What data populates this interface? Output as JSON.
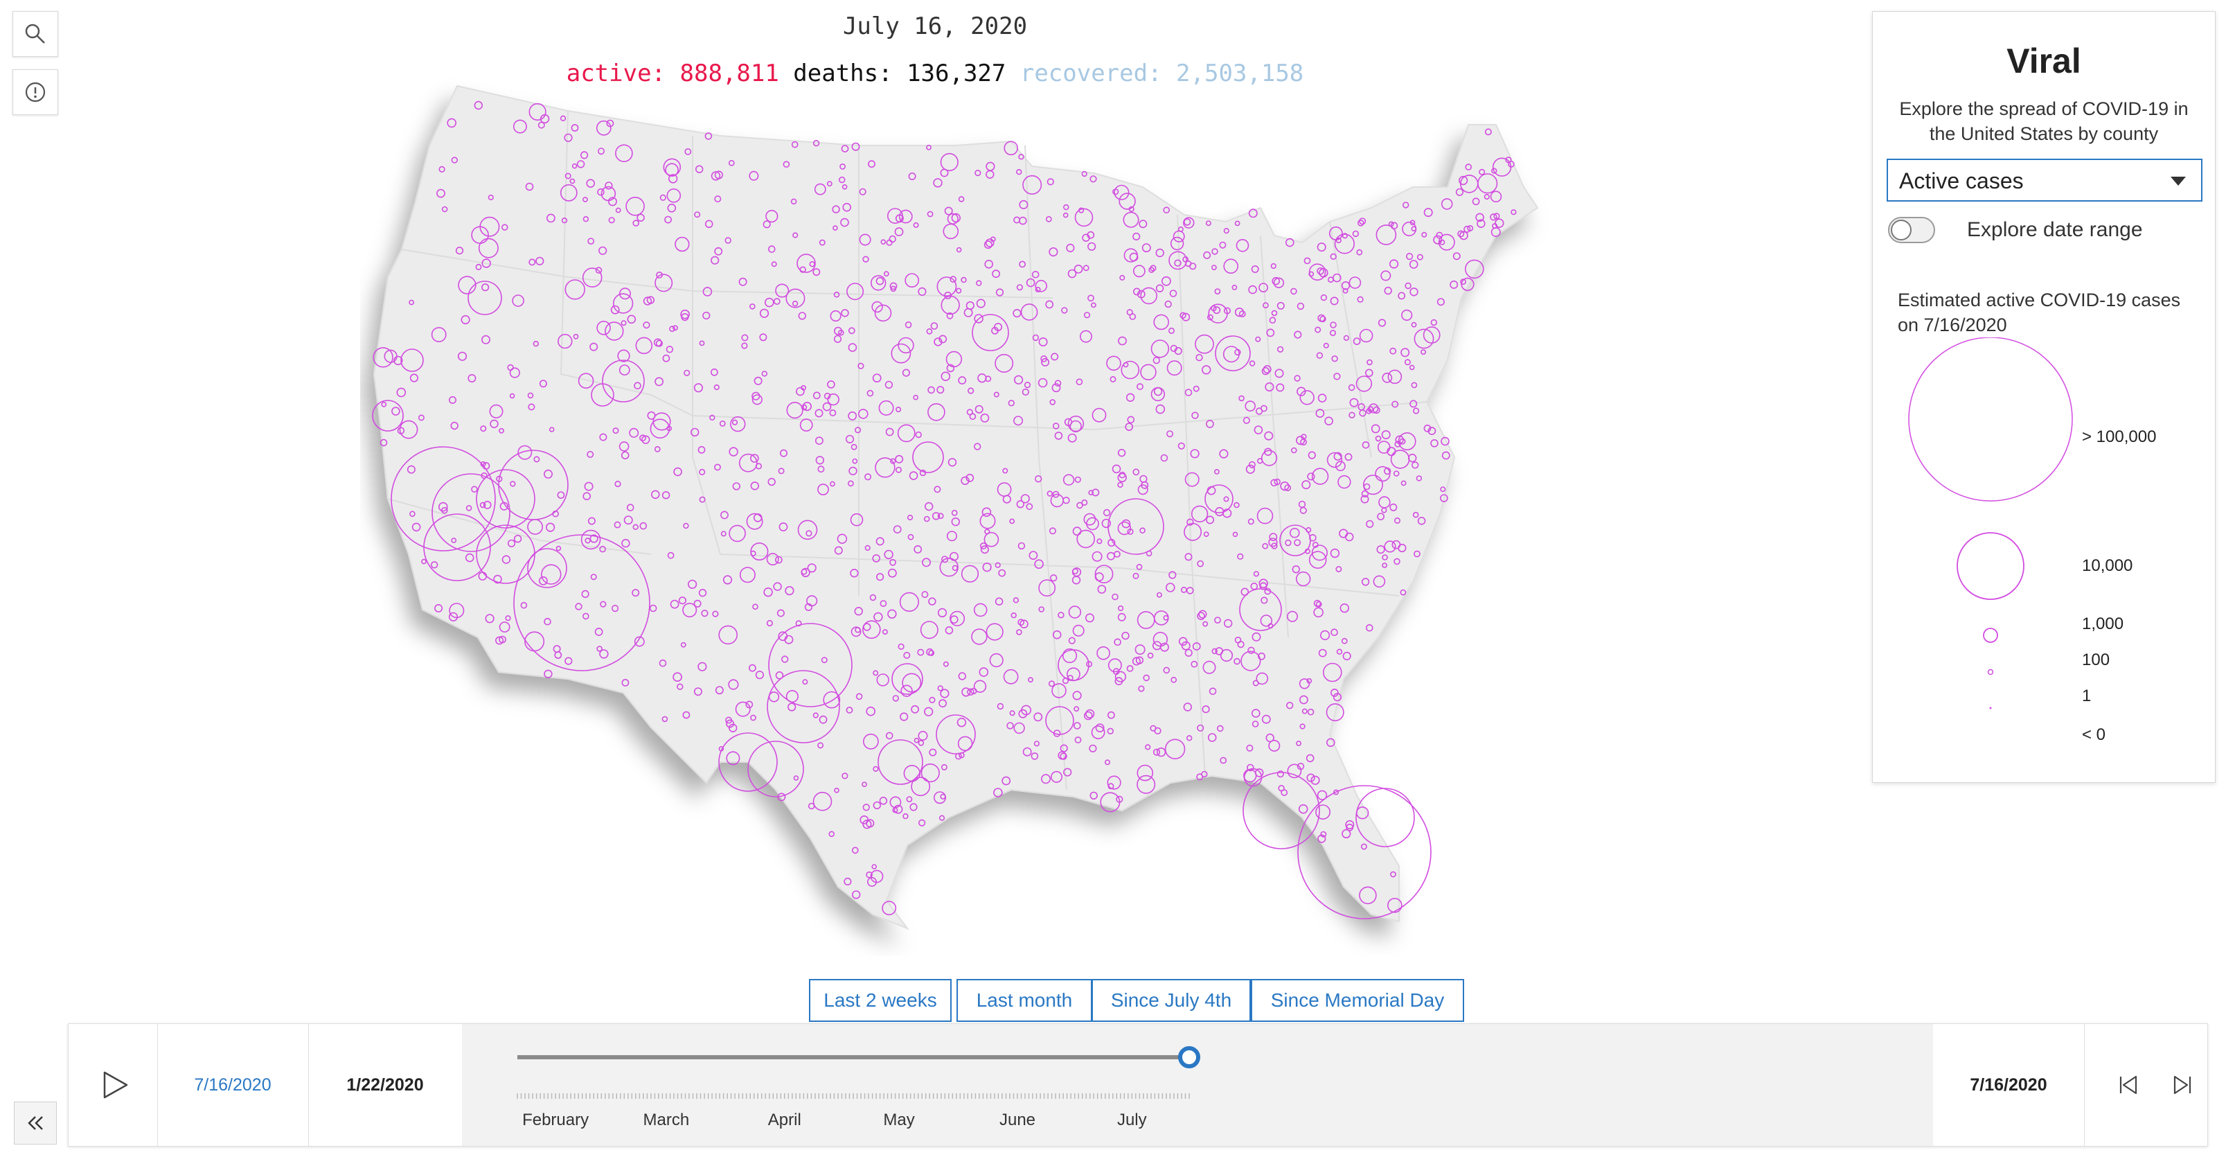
{
  "header": {
    "date": "July 16, 2020",
    "active_label": "active:",
    "active_value": "888,811",
    "deaths_label": "deaths:",
    "deaths_value": "136,327",
    "recovered_label": "recovered:",
    "recovered_value": "2,503,158"
  },
  "toolbar": {
    "search_icon": "search-icon",
    "info_icon": "info-icon"
  },
  "panel": {
    "title": "Viral",
    "description": "Explore the spread of COVID-19 in the United States by county",
    "dropdown_value": "Active cases",
    "toggle_label": "Explore date range",
    "toggle_on": false,
    "legend_title": "Estimated active COVID-19 cases on 7/16/2020",
    "legend": [
      {
        "label": "> 100,000"
      },
      {
        "label": "10,000"
      },
      {
        "label": "1,000"
      },
      {
        "label": "100"
      },
      {
        "label": "1"
      },
      {
        "label": "< 0"
      }
    ]
  },
  "presets": [
    "Last 2 weeks",
    "Last month",
    "Since July 4th",
    "Since Memorial Day"
  ],
  "slider": {
    "current_date": "7/16/2020",
    "min_date": "1/22/2020",
    "max_date": "7/16/2020",
    "months": [
      "February",
      "March",
      "April",
      "May",
      "June",
      "July"
    ],
    "position": 1.0
  },
  "colors": {
    "accent": "#2a78c4",
    "symbol": "#d24ce0",
    "active": "#e8184c",
    "recovered": "#a8c8e2"
  }
}
